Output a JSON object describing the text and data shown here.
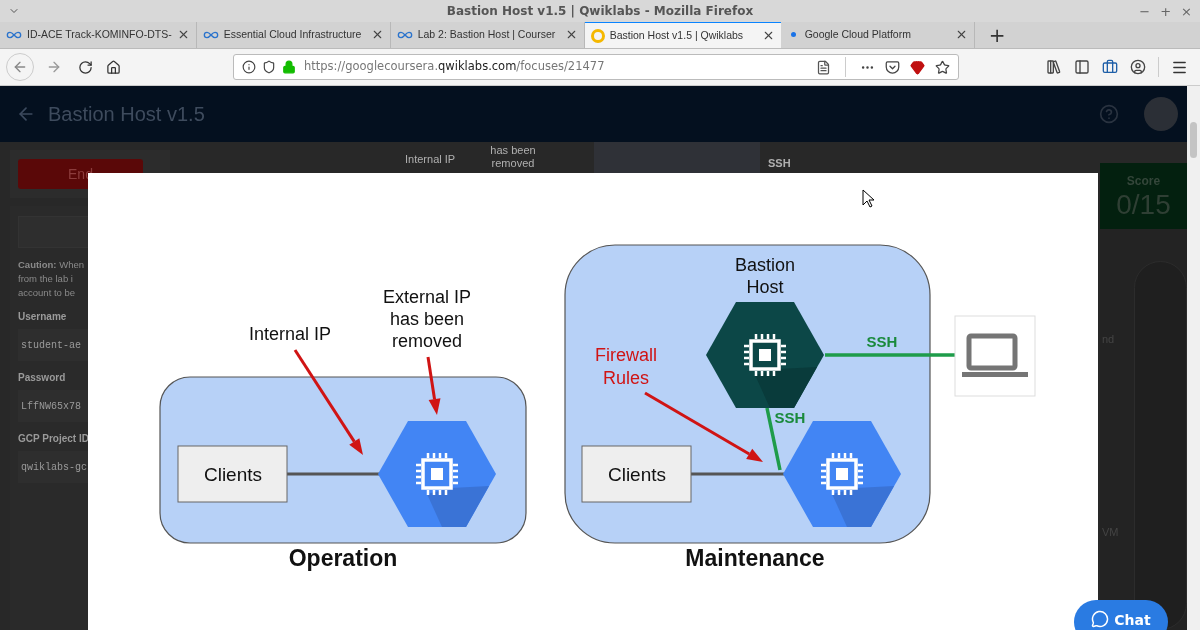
{
  "browser": {
    "window_title": "Bastion Host v1.5 | Qwiklabs - Mozilla Firefox",
    "window_controls": [
      "−",
      "+",
      "×"
    ],
    "tabs": [
      {
        "title": "ID-ACE Track-KOMINFO-DTS-",
        "kind": "coursera",
        "selected": false
      },
      {
        "title": "Essential Cloud Infrastructure",
        "kind": "coursera",
        "selected": false
      },
      {
        "title": "Lab 2: Bastion Host | Courser",
        "kind": "coursera",
        "selected": false
      },
      {
        "title": "Bastion Host v1.5 | Qwiklabs",
        "kind": "qwiklabs",
        "selected": true
      },
      {
        "title": "Google Cloud Platform",
        "kind": "google",
        "selected": false
      }
    ],
    "new_tab": "+",
    "url": {
      "prefix": "https://googlecoursera.",
      "host": "qwiklabs.com",
      "path": "/focuses/21477"
    }
  },
  "page": {
    "title": "Bastion Host v1.5",
    "end_button": "End",
    "caution": [
      "**Caution:** When",
      "from the lab i",
      "account to be"
    ],
    "credentials": [
      {
        "label": "Username",
        "value": "student-ae"
      },
      {
        "label": "Password",
        "value": "LffNW65x78"
      },
      {
        "label": "GCP Project ID",
        "value": "qwiklabs-gc"
      }
    ],
    "background_labels": [
      "Internal IP",
      "has been removed",
      "SSH"
    ],
    "score": {
      "label": "Score",
      "value": "0/15"
    },
    "side_texts": [
      "nd",
      "VM"
    ],
    "chat": "Chat"
  },
  "modal": {
    "operation": {
      "title": "Operation",
      "clients": "Clients",
      "internal_label": "Internal IP",
      "external_label": [
        "External IP",
        "has been",
        "removed"
      ]
    },
    "maintenance": {
      "title": "Maintenance",
      "clients": "Clients",
      "bastion_label": [
        "Bastion",
        "Host"
      ],
      "firewall_label": [
        "Firewall",
        "Rules"
      ],
      "ssh_labels": [
        "SSH",
        "SSH"
      ]
    }
  }
}
